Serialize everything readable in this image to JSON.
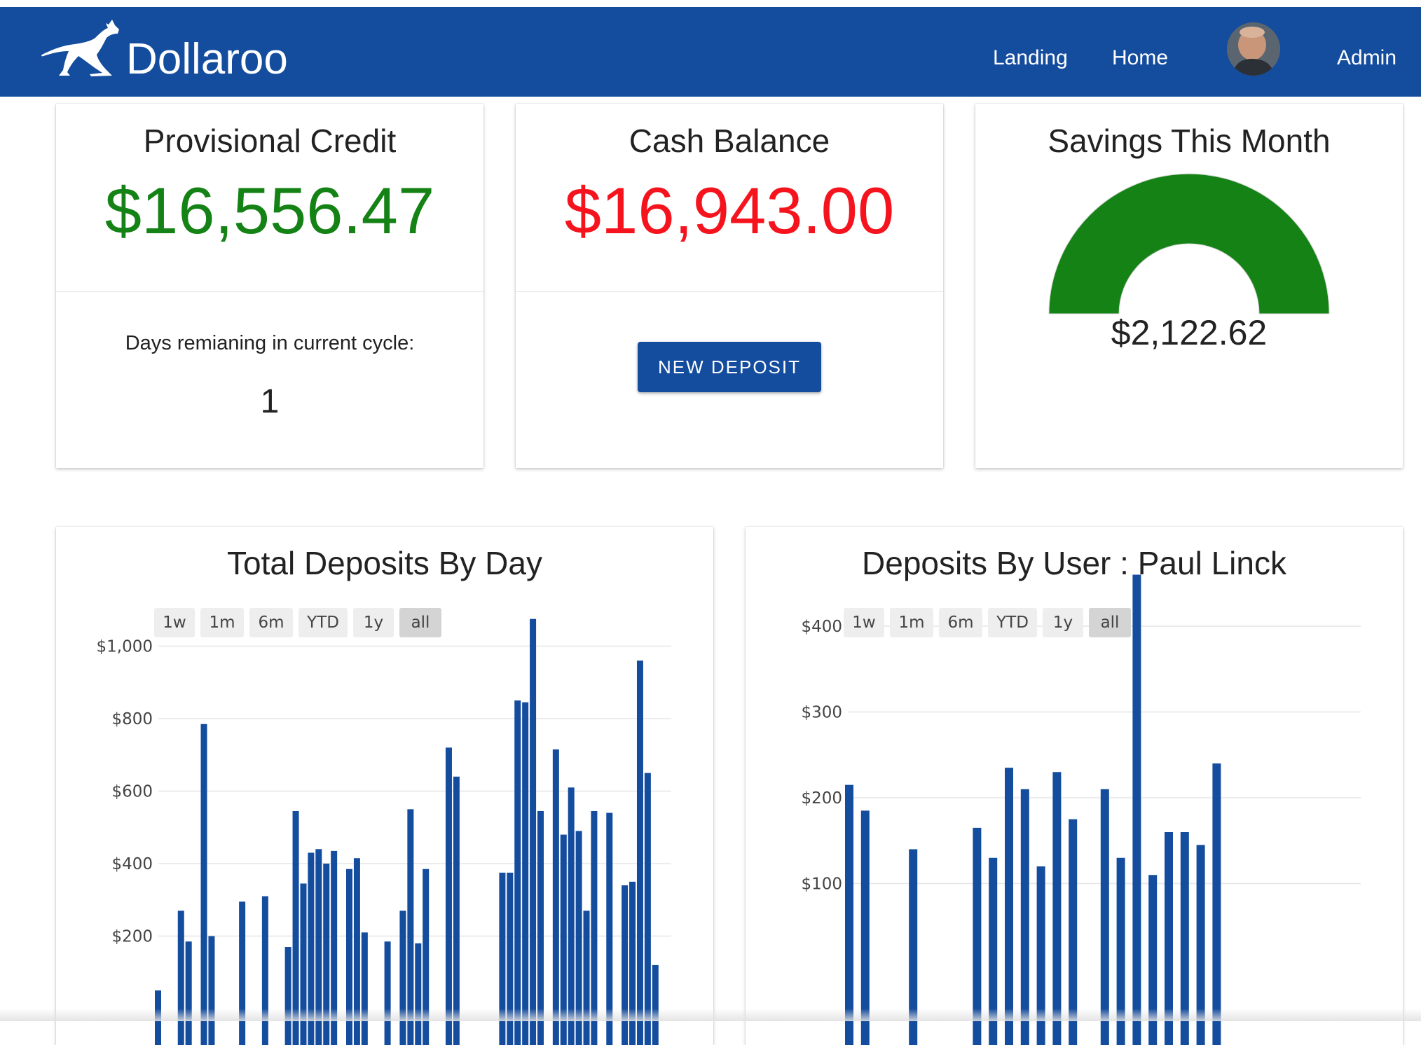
{
  "app": {
    "brand": "Dollaroo"
  },
  "nav": {
    "landing": "Landing",
    "home": "Home",
    "admin": "Admin"
  },
  "provisional_credit": {
    "title": "Provisional Credit",
    "amount": "$16,556.47",
    "cycle_label": "Days remianing in current cycle:",
    "days_remaining": "1"
  },
  "cash_balance": {
    "title": "Cash Balance",
    "amount": "$16,943.00",
    "button_label": "NEW DEPOSIT"
  },
  "savings": {
    "title": "Savings This Month",
    "amount": "$2,122.62",
    "gauge_fraction": 1.0
  },
  "range_buttons": [
    "1w",
    "1m",
    "6m",
    "YTD",
    "1y",
    "all"
  ],
  "active_range": "all",
  "colors": {
    "header": "#144c9e",
    "positive": "#148214",
    "negative": "#f5141e",
    "bar": "#144c9e",
    "gauge": "#148214"
  },
  "chart_data": [
    {
      "type": "bar",
      "title": "Total Deposits By Day",
      "y_ticks": [
        "$200",
        "$400",
        "$600",
        "$800",
        "$1,000"
      ],
      "values": [
        50,
        0,
        0,
        270,
        185,
        0,
        785,
        200,
        0,
        0,
        0,
        295,
        0,
        0,
        310,
        0,
        0,
        170,
        545,
        345,
        430,
        440,
        400,
        435,
        0,
        385,
        415,
        210,
        0,
        0,
        185,
        0,
        270,
        550,
        180,
        385,
        0,
        0,
        720,
        640,
        0,
        0,
        0,
        0,
        0,
        375,
        375,
        850,
        845,
        1075,
        545,
        0,
        715,
        480,
        610,
        490,
        270,
        545,
        0,
        540,
        0,
        340,
        350,
        960,
        650,
        120
      ]
    },
    {
      "type": "bar",
      "title": "Deposits By User : Paul Linck",
      "y_ticks": [
        "$100",
        "$200",
        "$300",
        "$400"
      ],
      "values": [
        215,
        185,
        0,
        0,
        140,
        0,
        0,
        0,
        165,
        130,
        235,
        210,
        120,
        230,
        175,
        0,
        210,
        130,
        460,
        110,
        160,
        160,
        145,
        240
      ]
    }
  ]
}
